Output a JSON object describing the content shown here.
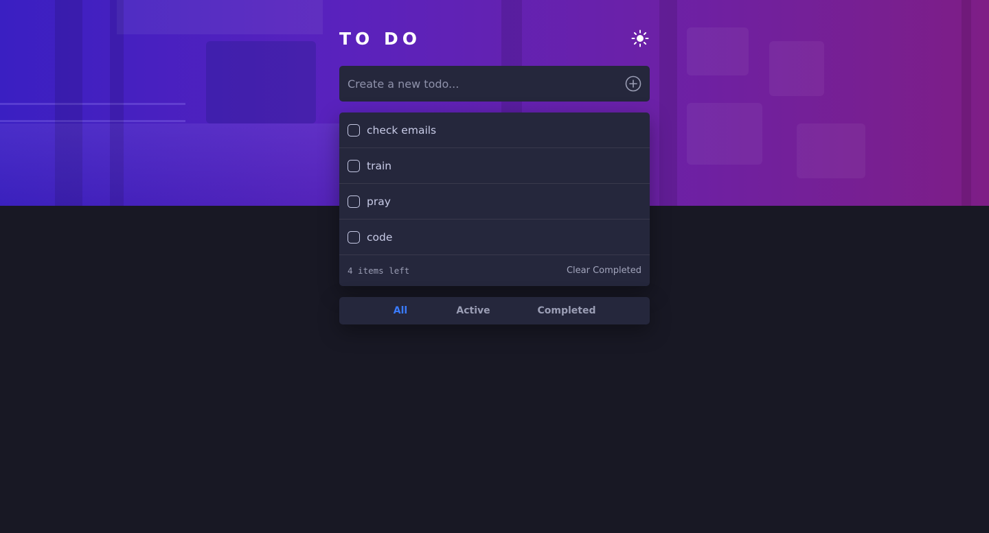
{
  "app": {
    "title": "TO DO",
    "theme_toggle_icon": "sun-icon"
  },
  "new_todo": {
    "placeholder": "Create a new todo...",
    "value": "",
    "add_icon": "plus-circle-icon"
  },
  "todos": [
    {
      "label": "check emails",
      "completed": false
    },
    {
      "label": "train",
      "completed": false
    },
    {
      "label": "pray",
      "completed": false
    },
    {
      "label": "code",
      "completed": false
    }
  ],
  "footer": {
    "items_left": "4 items left",
    "clear_label": "Clear Completed"
  },
  "filters": {
    "all": "All",
    "active": "Active",
    "completed": "Completed",
    "selected": "All"
  },
  "colors": {
    "background": "#181824",
    "panel": "#25273c",
    "text": "#c8cbe7",
    "muted": "#9b9eb5",
    "accent": "#3a7bfd",
    "divider": "#393a4c"
  }
}
